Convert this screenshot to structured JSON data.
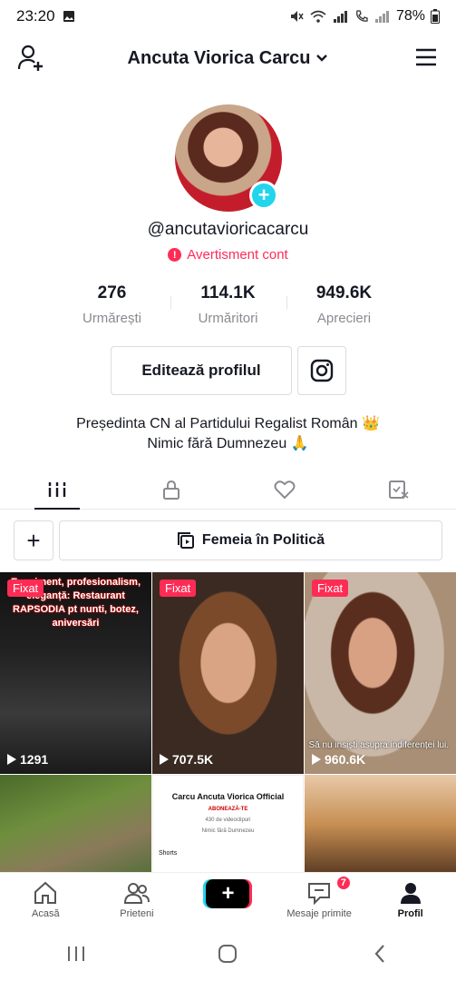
{
  "status_bar": {
    "time": "23:20",
    "battery": "78%"
  },
  "header": {
    "title": "Ancuta Viorica Carcu"
  },
  "profile": {
    "username": "@ancutavioricacarcu",
    "warning": "Avertisment cont",
    "stats": [
      {
        "value": "276",
        "label": "Urmărești"
      },
      {
        "value": "114.1K",
        "label": "Urmăritori"
      },
      {
        "value": "949.6K",
        "label": "Aprecieri"
      }
    ],
    "edit_label": "Editează profilul",
    "bio_line1": "Președinta CN al Partidului Regalist Român 👑",
    "bio_line2": "Nimic fără Dumnezeu 🙏"
  },
  "playlist": {
    "add_label": "+",
    "name": "Femeia în Politică"
  },
  "videos": [
    {
      "pinned": "Fixat",
      "views": "1291",
      "overlay": "Eveniment, profesionalism, eleganță: Restaurant RAPSODIA pt nunti, botez, aniversări"
    },
    {
      "pinned": "Fixat",
      "views": "707.5K"
    },
    {
      "pinned": "Fixat",
      "views": "960.6K",
      "caption": "Să nu insiști asupra indiferenței lui."
    },
    {},
    {
      "title": "Carcu Ancuta Viorica Official",
      "subtitle": "ABONEAZĂ-TE",
      "count": "430 de videoclipuri",
      "motto": "Nimic fără Dumnezeu",
      "section": "Shorts"
    },
    {}
  ],
  "bottom_nav": {
    "items": [
      {
        "label": "Acasă"
      },
      {
        "label": "Prieteni"
      },
      {
        "label": "+"
      },
      {
        "label": "Mesaje primite",
        "badge": "7"
      },
      {
        "label": "Profil"
      }
    ]
  },
  "colors": {
    "accent": "#fe2c55",
    "cyan": "#20d5ec",
    "text": "#161823",
    "muted": "#8a8b91"
  }
}
